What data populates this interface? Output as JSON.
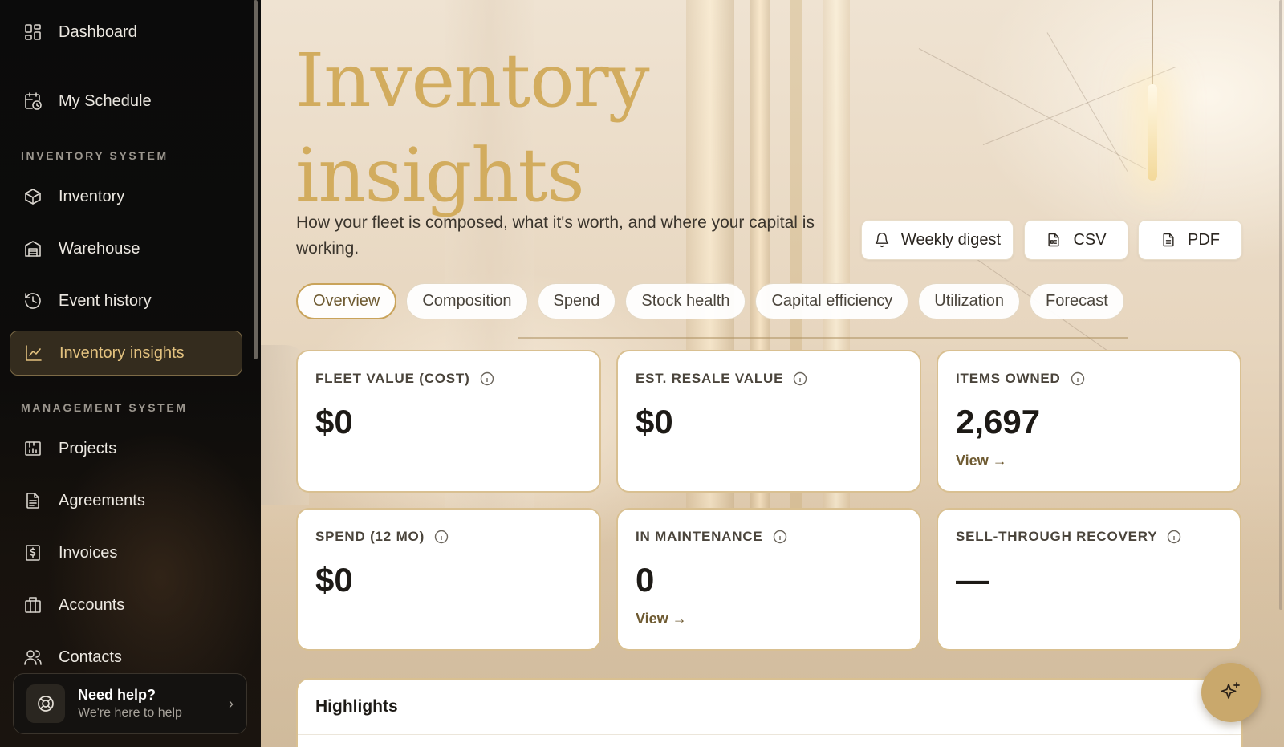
{
  "sidebar": {
    "top_items": [
      {
        "label": "Dashboard",
        "icon": "dashboard-icon"
      },
      {
        "label": "My Schedule",
        "icon": "calendar-clock-icon"
      }
    ],
    "sections": [
      {
        "label": "INVENTORY SYSTEM",
        "items": [
          {
            "label": "Inventory",
            "icon": "box-icon"
          },
          {
            "label": "Warehouse",
            "icon": "warehouse-icon"
          },
          {
            "label": "Event history",
            "icon": "history-icon"
          },
          {
            "label": "Inventory insights",
            "icon": "line-chart-icon",
            "active": true
          }
        ]
      },
      {
        "label": "MANAGEMENT SYSTEM",
        "items": [
          {
            "label": "Projects",
            "icon": "projects-icon"
          },
          {
            "label": "Agreements",
            "icon": "document-icon"
          },
          {
            "label": "Invoices",
            "icon": "invoice-icon"
          },
          {
            "label": "Accounts",
            "icon": "building-icon"
          },
          {
            "label": "Contacts",
            "icon": "users-icon"
          }
        ]
      }
    ],
    "help": {
      "title": "Need help?",
      "subtitle": "We're here to help",
      "icon": "lifebuoy-icon"
    }
  },
  "header": {
    "title_line1": "Inventory",
    "title_line2": "insights",
    "subtitle": "How your fleet is composed, what it's worth, and where your capital is working."
  },
  "actions": {
    "digest_label": "Weekly digest",
    "csv_label": "CSV",
    "pdf_label": "PDF"
  },
  "tabs": [
    {
      "label": "Overview",
      "active": true
    },
    {
      "label": "Composition"
    },
    {
      "label": "Spend"
    },
    {
      "label": "Stock health"
    },
    {
      "label": "Capital efficiency"
    },
    {
      "label": "Utilization"
    },
    {
      "label": "Forecast"
    }
  ],
  "cards": [
    {
      "label": "FLEET VALUE (COST)",
      "value": "$0",
      "link": ""
    },
    {
      "label": "EST. RESALE VALUE",
      "value": "$0",
      "link": ""
    },
    {
      "label": "ITEMS OWNED",
      "value": "2,697",
      "link": "View →"
    },
    {
      "label": "SPEND (12 MO)",
      "value": "$0",
      "link": ""
    },
    {
      "label": "IN MAINTENANCE",
      "value": "0",
      "link": "View →"
    },
    {
      "label": "SELL-THROUGH RECOVERY",
      "value": "—",
      "link": ""
    }
  ],
  "highlights": {
    "title": "Highlights"
  },
  "colors": {
    "accent": "#d2ac5e",
    "active_nav_text": "#e3c27f",
    "card_border": "#d9c091",
    "fab": "#c9a86c"
  }
}
